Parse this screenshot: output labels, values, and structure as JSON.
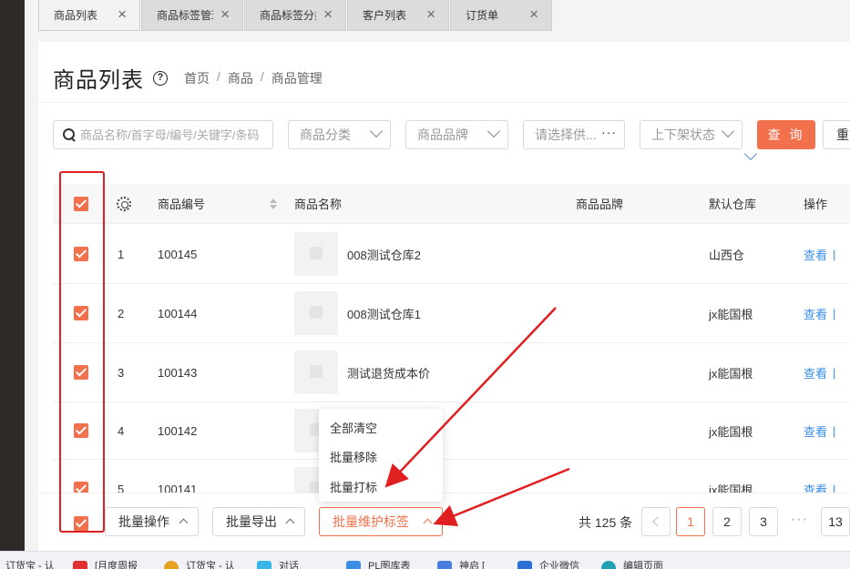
{
  "tabs": [
    {
      "label": "商品列表",
      "active": true
    },
    {
      "label": "商品标签管理",
      "active": false
    },
    {
      "label": "商品标签分类",
      "active": false
    },
    {
      "label": "客户列表",
      "active": false
    },
    {
      "label": "订货单",
      "active": false
    }
  ],
  "header": {
    "title": "商品列表",
    "help": "?",
    "breadcrumb": [
      "首页",
      "商品",
      "商品管理"
    ]
  },
  "filters": {
    "search_placeholder": "商品名称/首字母/编号/关键字/条码",
    "category": "商品分类",
    "brand": "商品品牌",
    "supplier": "请选择供...",
    "supplier_more": "···",
    "shelf_status": "上下架状态",
    "query_label": "查 询",
    "reset_label": "重"
  },
  "table": {
    "headers": {
      "no": "商品编号",
      "name": "商品名称",
      "brand": "商品品牌",
      "warehouse": "默认仓库",
      "action": "操作"
    },
    "rows": [
      {
        "index": "1",
        "code": "100145",
        "name": "008测试仓库2",
        "brand": "",
        "warehouse": "山西仓",
        "action": "查看"
      },
      {
        "index": "2",
        "code": "100144",
        "name": "008测试仓库1",
        "brand": "",
        "warehouse": "jx能国根",
        "action": "查看"
      },
      {
        "index": "3",
        "code": "100143",
        "name": "测试退货成本价",
        "brand": "",
        "warehouse": "jx能国根",
        "action": "查看"
      },
      {
        "index": "4",
        "code": "100142",
        "name": "",
        "brand": "",
        "warehouse": "jx能国根",
        "action": "查看"
      },
      {
        "index": "5",
        "code": "100141",
        "name": "",
        "brand": "",
        "warehouse": "jx能国根",
        "action": "查看"
      }
    ]
  },
  "bottom": {
    "batch_ops": "批量操作",
    "batch_export": "批量导出",
    "batch_tags": "批量维护标签",
    "total": "共 125 条",
    "pages": [
      "1",
      "2",
      "3"
    ],
    "last_page": "13",
    "ellipsis": "···"
  },
  "dropdown": {
    "items": [
      "全部清空",
      "批量移除",
      "批量打标"
    ]
  },
  "taskbar": {
    "items": [
      "订货宝 - 认",
      "[月度周报",
      "订货宝 - 认",
      "对话",
      "PL图库表",
      "神启 [",
      "企业微信",
      "编辑页面"
    ]
  },
  "colors": {
    "accent": "#f2704c",
    "link": "#3a8ee6",
    "annotation": "#e02020"
  }
}
